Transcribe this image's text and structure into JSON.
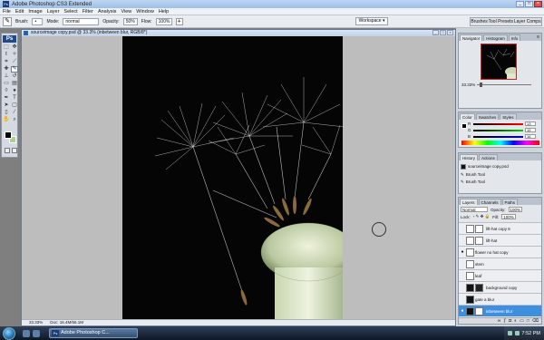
{
  "window": {
    "title": "Adobe Photoshop CS3 Extended",
    "controls": [
      "_",
      "□",
      "×"
    ]
  },
  "menu": [
    "File",
    "Edit",
    "Image",
    "Layer",
    "Select",
    "Filter",
    "Analysis",
    "View",
    "Window",
    "Help"
  ],
  "options_bar": {
    "brush_label": "Brush:",
    "mode_label": "Mode:",
    "mode_value": "normal",
    "opacity_label": "Opacity:",
    "opacity_value": "50%",
    "flow_label": "Flow:",
    "flow_value": "100%",
    "workspace_label": "Workspace ▾",
    "right_tabs": [
      "Brushes",
      "Tool Presets",
      "Layer Comps"
    ]
  },
  "document": {
    "title": "sourceimage copy.psd @ 33.3% (inbetween blur, RGB/8*)",
    "zoom": "33.33%",
    "doc_info": "Doc: 16.4M/66.1M"
  },
  "navigator": {
    "tabs": [
      "Navigator",
      "Histogram",
      "Info"
    ],
    "zoom": "33.33%"
  },
  "color_panel": {
    "tabs": [
      "Color",
      "Swatches",
      "Styles"
    ],
    "channels": [
      {
        "label": "R",
        "value": "13",
        "color": "#e33"
      },
      {
        "label": "G",
        "value": "15",
        "color": "#3c3"
      },
      {
        "label": "B",
        "value": "16",
        "color": "#33c"
      }
    ]
  },
  "history_panel": {
    "tabs": [
      "History",
      "Actions"
    ],
    "snapshot": "sourceimage copy.psd",
    "items": [
      "Brush Tool",
      "Brush Tool"
    ]
  },
  "layers_panel": {
    "tabs": [
      "Layers",
      "Channels",
      "Paths"
    ],
    "blend": "Normal",
    "opacity_label": "Opacity:",
    "opacity": "100%",
    "lock_label": "Lock:",
    "fill_label": "Fill:",
    "fill": "100%",
    "layers": [
      {
        "name": "lift-hat copy 6",
        "visible": false,
        "active": false
      },
      {
        "name": "lift-hat",
        "visible": false,
        "active": false
      },
      {
        "name": "flower no hat copy",
        "visible": true,
        "active": false
      },
      {
        "name": "stem",
        "visible": false,
        "active": false
      },
      {
        "name": "leaf",
        "visible": false,
        "active": false
      },
      {
        "name": "background copy",
        "visible": false,
        "active": false
      },
      {
        "name": "gate a blur",
        "visible": false,
        "active": false
      },
      {
        "name": "inbetween blur",
        "visible": true,
        "active": true
      }
    ]
  },
  "taskbar": {
    "task": "Adobe Photoshop C...",
    "clock": "7:52 PM"
  }
}
